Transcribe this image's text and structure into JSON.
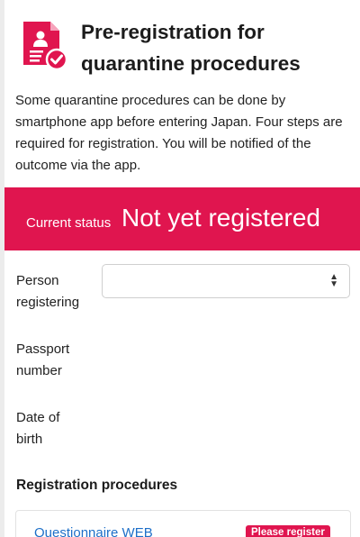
{
  "header": {
    "title": "Pre-registration for quarantine procedures",
    "icon": "registration-form-check-icon",
    "accent_color": "#e0154f"
  },
  "intro": {
    "text": "Some quarantine procedures can be done by smartphone app before entering Japan. Four steps are required for registration. You will be notified of the outcome via the app."
  },
  "status": {
    "label": "Current status",
    "value": "Not yet registered"
  },
  "form": {
    "person_label_line1": "Person",
    "person_label_line2": "registering",
    "person_value": "",
    "passport_label_line1": "Passport",
    "passport_label_line2": "number",
    "dob_label_line1": "Date of",
    "dob_label_line2": "birth"
  },
  "procedures": {
    "title": "Registration procedures",
    "items": [
      {
        "label": "Questionnaire WEB",
        "badge": "Please register"
      }
    ]
  }
}
